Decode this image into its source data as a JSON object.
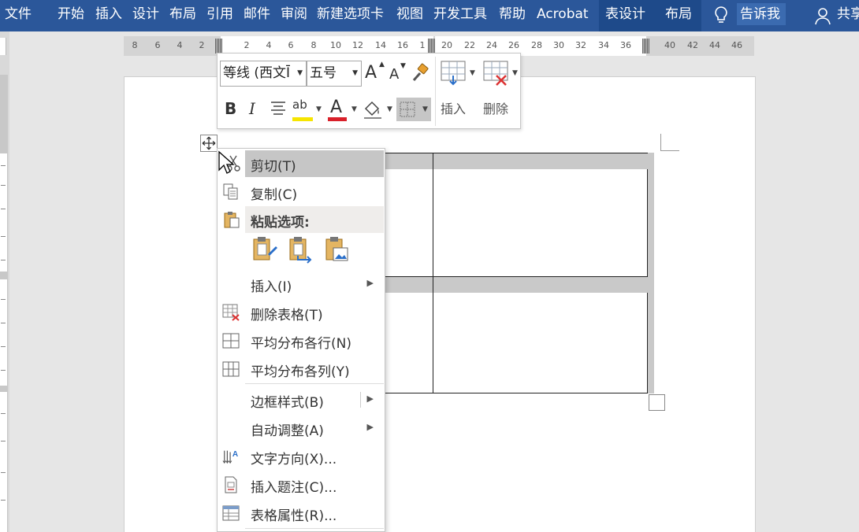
{
  "ribbon": {
    "tabs": [
      "文件",
      "开始",
      "插入",
      "设计",
      "布局",
      "引用",
      "邮件",
      "审阅",
      "新建选项卡",
      "视图",
      "开发工具",
      "帮助",
      "Acrobat",
      "表设计",
      "布局"
    ],
    "tell_me": "告诉我",
    "share": "共享"
  },
  "ruler": {
    "numbers": [
      "8",
      "6",
      "4",
      "2",
      "2",
      "4",
      "6",
      "8",
      "10",
      "12",
      "14",
      "16",
      "1",
      "20",
      "22",
      "24",
      "26",
      "28",
      "30",
      "32",
      "34",
      "36",
      "40",
      "42",
      "44",
      "46"
    ]
  },
  "mini_toolbar": {
    "font_name": "等线 (西文Ī",
    "font_size": "五号",
    "grow_font": "A",
    "shrink_font": "A",
    "bold": "B",
    "italic": "I",
    "font_color_letter": "A",
    "highlight_text": "ab",
    "insert_label": "插入",
    "delete_label": "删除",
    "colors": {
      "highlight": "#f6e500",
      "font_color": "#d9202a"
    }
  },
  "context_menu": {
    "cut": "剪切(T)",
    "copy": "复制(C)",
    "paste_options": "粘贴选项:",
    "insert": "插入(I)",
    "delete_table": "删除表格(T)",
    "distribute_rows": "平均分布各行(N)",
    "distribute_columns": "平均分布各列(Y)",
    "border_styles": "边框样式(B)",
    "autofit": "自动调整(A)",
    "text_direction": "文字方向(X)...",
    "insert_caption": "插入题注(C)...",
    "table_properties": "表格属性(R)..."
  }
}
